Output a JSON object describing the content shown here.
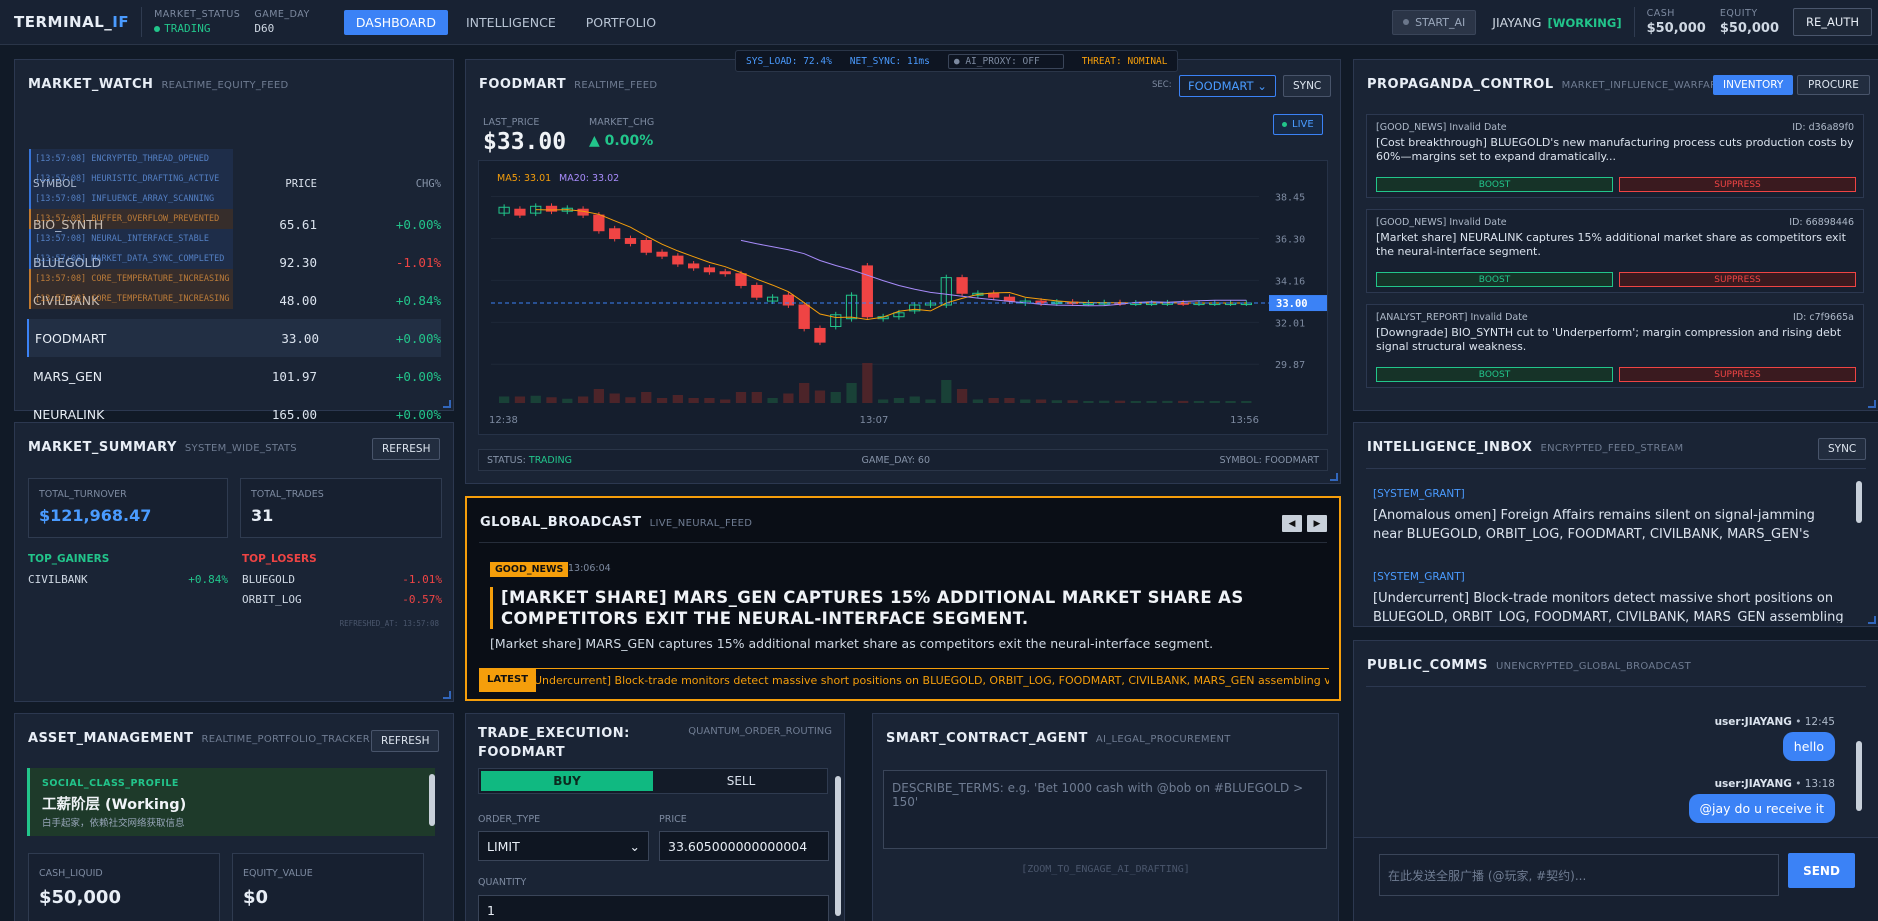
{
  "topbar": {
    "brand_main": "TERMINAL_",
    "brand_accent": "IF",
    "market_status_label": "MARKET_STATUS",
    "market_status_value": "TRADING",
    "game_day_label": "GAME_DAY",
    "game_day_value": "D60",
    "nav": [
      "DASHBOARD",
      "INTELLIGENCE",
      "PORTFOLIO"
    ],
    "start_ai": "START_AI",
    "user": "JIAYANG",
    "user_status": "[WORKING]",
    "cash_label": "CASH",
    "cash_value": "$50,000",
    "equity_label": "EQUITY",
    "equity_value": "$50,000",
    "reauth": "RE_AUTH"
  },
  "market_watch": {
    "title": "MARKET_WATCH",
    "subtitle": "REALTIME_EQUITY_FEED",
    "col_symbol": "SYMBOL",
    "col_price": "PRICE",
    "col_chg": "CHG%",
    "rows": [
      {
        "symbol": "BIO_SYNTH",
        "price": "65.61",
        "chg": "+0.00%",
        "dir": "up"
      },
      {
        "symbol": "BLUEGOLD",
        "price": "92.30",
        "chg": "-1.01%",
        "dir": "dn"
      },
      {
        "symbol": "CIVILBANK",
        "price": "48.00",
        "chg": "+0.84%",
        "dir": "up"
      },
      {
        "symbol": "FOODMART",
        "price": "33.00",
        "chg": "+0.00%",
        "dir": "up"
      },
      {
        "symbol": "MARS_GEN",
        "price": "101.97",
        "chg": "+0.00%",
        "dir": "up"
      },
      {
        "symbol": "NEURALINK",
        "price": "165.00",
        "chg": "+0.00%",
        "dir": "up"
      }
    ],
    "logs": [
      {
        "text": "[13:57:08] ENCRYPTED_THREAD_OPENED",
        "kind": "b"
      },
      {
        "text": "[13:57:08] HEURISTIC_DRAFTING_ACTIVE",
        "kind": "b"
      },
      {
        "text": "[13:57:08] INFLUENCE_ARRAY_SCANNING",
        "kind": "b"
      },
      {
        "text": "[13:57:08] BUFFER_OVERFLOW_PREVENTED",
        "kind": "o"
      },
      {
        "text": "[13:57:08] NEURAL_INTERFACE_STABLE",
        "kind": "b"
      },
      {
        "text": "[13:57:08] MARKET_DATA_SYNC_COMPLETED",
        "kind": "b"
      },
      {
        "text": "[13:57:08] CORE_TEMPERATURE_INCREASING",
        "kind": "o"
      },
      {
        "text": "[13:57:08] CORE_TEMPERATURE_INCREASING",
        "kind": "o"
      }
    ]
  },
  "market_summary": {
    "title": "MARKET_SUMMARY",
    "subtitle": "SYSTEM_WIDE_STATS",
    "refresh": "REFRESH",
    "turnover_label": "TOTAL_TURNOVER",
    "turnover_value": "$121,968.47",
    "trades_label": "TOTAL_TRADES",
    "trades_value": "31",
    "gainers_label": "TOP_GAINERS",
    "losers_label": "TOP_LOSERS",
    "gainers": [
      {
        "symbol": "CIVILBANK",
        "chg": "+0.84%"
      }
    ],
    "losers": [
      {
        "symbol": "BLUEGOLD",
        "chg": "-1.01%"
      },
      {
        "symbol": "ORBIT_LOG",
        "chg": "-0.57%"
      }
    ],
    "refreshed": "REFRESHED_AT: 13:57:08"
  },
  "status_strip": {
    "sys_load": "SYS_LOAD: 72.4%",
    "net_sync": "NET_SYNC: 11ms",
    "ai_proxy": "AI_PROXY: OFF",
    "threat": "THREAT: NOMINAL"
  },
  "foodmart": {
    "title": "FOODMART",
    "subtitle": "REALTIME_FEED",
    "sec_label": "SEC:",
    "sec_value": "FOODMART",
    "sync": "SYNC",
    "last_price_label": "LAST_PRICE",
    "last_price": "$33.00",
    "market_chg_label": "MARKET_CHG",
    "market_chg": "0.00%",
    "live": "LIVE",
    "footer_status_label": "STATUS:",
    "footer_status": "TRADING",
    "footer_day": "GAME_DAY: 60",
    "footer_symbol": "SYMBOL: FOODMART"
  },
  "chart_data": {
    "type": "candlestick",
    "title": "",
    "legend": [
      "MA5: 33.01",
      "MA20: 33.02"
    ],
    "x_ticks": [
      "12:38",
      "13:07",
      "13:56"
    ],
    "y_ticks": [
      38.45,
      36.3,
      34.16,
      32.01,
      29.87
    ],
    "ylim": [
      28.5,
      39.5
    ],
    "current_price": 33.0,
    "current_price_label": "33.00",
    "candles": [
      {
        "o": 37.6,
        "c": 37.9
      },
      {
        "o": 37.8,
        "c": 37.5
      },
      {
        "o": 37.6,
        "c": 37.95
      },
      {
        "o": 37.95,
        "c": 37.7
      },
      {
        "o": 37.7,
        "c": 37.85
      },
      {
        "o": 37.8,
        "c": 37.5
      },
      {
        "o": 37.5,
        "c": 36.7
      },
      {
        "o": 36.8,
        "c": 36.3
      },
      {
        "o": 36.3,
        "c": 36.05
      },
      {
        "o": 36.2,
        "c": 35.6
      },
      {
        "o": 35.6,
        "c": 35.4
      },
      {
        "o": 35.4,
        "c": 35.0
      },
      {
        "o": 35.0,
        "c": 34.8
      },
      {
        "o": 34.8,
        "c": 34.6
      },
      {
        "o": 34.6,
        "c": 34.5
      },
      {
        "o": 34.5,
        "c": 33.9
      },
      {
        "o": 33.9,
        "c": 33.3
      },
      {
        "o": 33.1,
        "c": 33.3
      },
      {
        "o": 33.4,
        "c": 32.9
      },
      {
        "o": 32.9,
        "c": 31.7
      },
      {
        "o": 31.7,
        "c": 31.0
      },
      {
        "o": 31.8,
        "c": 32.4
      },
      {
        "o": 32.2,
        "c": 33.4
      },
      {
        "o": 34.9,
        "c": 32.3
      },
      {
        "o": 32.2,
        "c": 32.3
      },
      {
        "o": 32.3,
        "c": 32.5
      },
      {
        "o": 32.6,
        "c": 32.9
      },
      {
        "o": 32.9,
        "c": 33.0
      },
      {
        "o": 32.9,
        "c": 34.3
      },
      {
        "o": 34.3,
        "c": 33.5
      },
      {
        "o": 33.4,
        "c": 33.5
      },
      {
        "o": 33.5,
        "c": 33.3
      },
      {
        "o": 33.3,
        "c": 33.1
      },
      {
        "o": 33.0,
        "c": 33.1
      },
      {
        "o": 33.1,
        "c": 33.0
      },
      {
        "o": 33.0,
        "c": 33.05
      },
      {
        "o": 33.05,
        "c": 33.0
      },
      {
        "o": 33.0,
        "c": 33.0
      },
      {
        "o": 33.0,
        "c": 33.02
      },
      {
        "o": 33.02,
        "c": 33.0
      },
      {
        "o": 33.0,
        "c": 33.0
      },
      {
        "o": 33.0,
        "c": 33.0
      },
      {
        "o": 33.0,
        "c": 33.01
      },
      {
        "o": 33.01,
        "c": 33.0
      },
      {
        "o": 33.0,
        "c": 33.0
      },
      {
        "o": 33.0,
        "c": 33.0
      },
      {
        "o": 33.0,
        "c": 33.0
      },
      {
        "o": 33.0,
        "c": 33.0
      }
    ]
  },
  "broadcast": {
    "title": "GLOBAL_BROADCAST",
    "subtitle": "LIVE_NEURAL_FEED",
    "tag": "GOOD_NEWS",
    "time": "13:06:04",
    "headline": "[MARKET SHARE] MARS_GEN CAPTURES 15% ADDITIONAL MARKET SHARE AS COMPETITORS EXIT THE NEURAL-INTERFACE SEGMENT.",
    "body": "[Market share] MARS_GEN captures 15% additional market share as competitors exit the neural-interface segment.",
    "latest": "LATEST",
    "ticker": "Undercurrent] Block-trade monitors detect massive short positions on BLUEGOLD, ORBIT_LOG, FOODMART, CIVILBANK, MARS_GEN assembling via pro"
  },
  "propaganda": {
    "title": "PROPAGANDA_CONTROL",
    "subtitle": "MARKET_INFLUENCE_WARFARE",
    "inventory": "INVENTORY",
    "procure": "PROCURE",
    "boost": "BOOST",
    "suppress": "SUPPRESS",
    "items": [
      {
        "meta": "[GOOD_NEWS] Invalid Date",
        "id": "ID: d36a89f0",
        "body": "[Cost breakthrough] BLUEGOLD's new manufacturing process cuts production costs by 60%—margins set to expand dramatically..."
      },
      {
        "meta": "[GOOD_NEWS] Invalid Date",
        "id": "ID: 66898446",
        "body": "[Market share] NEURALINK captures 15% additional market share as competitors exit the neural-interface segment."
      },
      {
        "meta": "[ANALYST_REPORT] Invalid Date",
        "id": "ID: c7f9665a",
        "body": "[Downgrade] BIO_SYNTH cut to 'Underperform'; margin compression and rising debt signal structural weakness."
      }
    ]
  },
  "inbox": {
    "title": "INTELLIGENCE_INBOX",
    "subtitle": "ENCRYPTED_FEED_STREAM",
    "sync": "SYNC",
    "items": [
      {
        "tag": "[SYSTEM_GRANT]",
        "text": "[Anomalous omen] Foreign Affairs remains silent on signal-jamming near BLUEGOLD, ORBIT_LOG, FOODMART, CIVILBANK, MARS_GEN's interests—..."
      },
      {
        "tag": "[SYSTEM_GRANT]",
        "text": "[Undercurrent] Block-trade monitors detect massive short positions on BLUEGOLD, ORBIT_LOG, FOODMART, CIVILBANK, MARS_GEN assembling"
      }
    ]
  },
  "comms": {
    "title": "PUBLIC_COMMS",
    "subtitle": "UNENCRYPTED_GLOBAL_BROADCAST",
    "messages": [
      {
        "user": "user:JIAYANG",
        "time": " • 12:45",
        "text": "hello"
      },
      {
        "user": "user:JIAYANG",
        "time": " • 13:18",
        "text": "@jay do u receive it"
      }
    ],
    "placeholder": "在此发送全服广播 (@玩家, #契约)...",
    "send": "SEND"
  },
  "asset": {
    "title": "ASSET_MANAGEMENT",
    "subtitle": "REALTIME_PORTFOLIO_TRACKER",
    "refresh": "REFRESH",
    "profile_label": "SOCIAL_CLASS_PROFILE",
    "profile_value": "工薪阶层 (Working)",
    "profile_sub": "白手起家，依赖社交网络获取信息",
    "cash_label": "CASH_LIQUID",
    "cash_value": "$50,000",
    "equity_label": "EQUITY_VALUE",
    "equity_value": "$0"
  },
  "trade": {
    "title_1": "TRADE_EXECUTION:",
    "title_2": "FOODMART",
    "subtitle": "QUANTUM_ORDER_ROUTING",
    "buy": "BUY",
    "sell": "SELL",
    "order_type_label": "ORDER_TYPE",
    "order_type_value": "LIMIT",
    "price_label": "PRICE",
    "price_value": "33.605000000000004",
    "quantity_label": "QUANTITY",
    "quantity_value": "1"
  },
  "contract": {
    "title": "SMART_CONTRACT_AGENT",
    "subtitle": "AI_LEGAL_PROCUREMENT",
    "placeholder": "DESCRIBE_TERMS: e.g. 'Bet 1000 cash with @bob on #BLUEGOLD > 150'",
    "hint": "[ZOOM_TO_ENGAGE_AI_DRAFTING]"
  },
  "colors": {
    "accent": "#3b82f6",
    "up": "#22c58b",
    "down": "#ef4444",
    "warn": "#f59e0b"
  }
}
